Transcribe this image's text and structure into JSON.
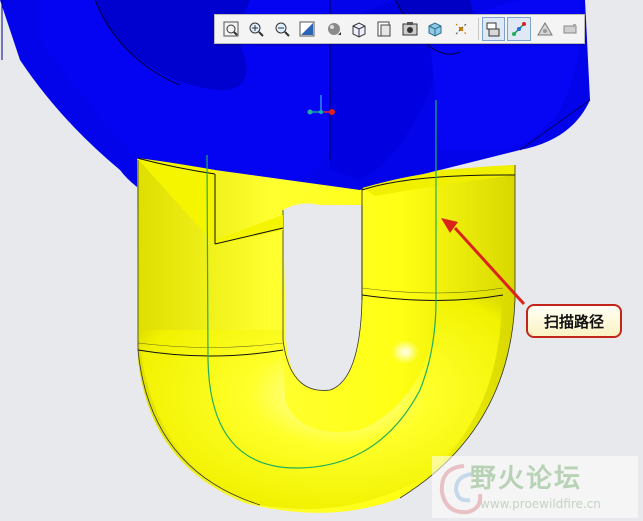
{
  "callout": {
    "label": "扫描路径"
  },
  "watermark": {
    "title": "野火论坛",
    "url": "www.proewildfire.cn"
  },
  "toolbar": {
    "buttons": [
      {
        "icon": "zoom-fit-icon"
      },
      {
        "icon": "zoom-in-icon"
      },
      {
        "icon": "zoom-out-icon"
      },
      {
        "icon": "repaint-icon"
      },
      {
        "icon": "display-style-icon"
      },
      {
        "icon": "saved-view-icon"
      },
      {
        "icon": "view-manager-icon"
      },
      {
        "icon": "render-view-icon"
      },
      {
        "icon": "orient-icon"
      },
      {
        "icon": "datum-display-icon"
      },
      {
        "icon": "plane-display-icon"
      },
      {
        "icon": "axis-display-icon"
      },
      {
        "icon": "point-display-icon"
      },
      {
        "icon": "csys-display-icon"
      }
    ]
  },
  "colors": {
    "blue_solid": "#0505ee",
    "yellow_solid": "#ffff1e",
    "path_line": "#1faf5a",
    "arrow": "#d9241c",
    "background": "#e8e9ec"
  }
}
